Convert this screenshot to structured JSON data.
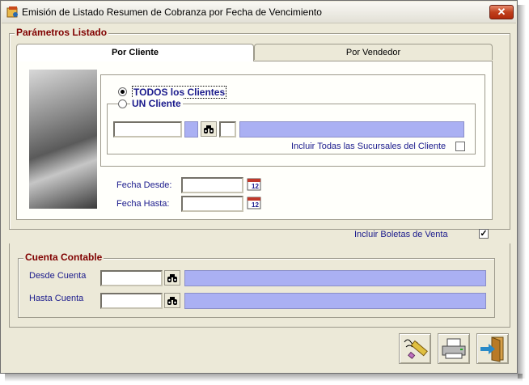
{
  "window": {
    "title": "Emisión de Listado Resumen de Cobranza por Fecha de Vencimiento",
    "close_glyph": "✕"
  },
  "parametros": {
    "label": "Parámetros Listado",
    "tabs": [
      {
        "label": "Por Cliente",
        "active": true
      },
      {
        "label": "Por Vendedor",
        "active": false
      }
    ],
    "radio_todos": "TODOS los Clientes",
    "radio_uno": "UN Cliente",
    "selected": "TODOS los Clientes",
    "cliente_codigo": "",
    "cliente_suc": "",
    "cliente_nro": "",
    "cliente_nombre": "",
    "incluir_sucursales_label": "Incluir Todas las Sucursales del Cliente",
    "incluir_sucursales_checked": false,
    "fecha_desde_label": "Fecha Desde:",
    "fecha_desde_value": "",
    "fecha_hasta_label": "Fecha Hasta:",
    "fecha_hasta_value": ""
  },
  "boletas": {
    "label": "Incluir Boletas de Venta",
    "checked": true,
    "check_glyph": "✓"
  },
  "cuenta": {
    "label": "Cuenta Contable",
    "desde_label": "Desde Cuenta",
    "desde_value": "",
    "desde_desc": "",
    "hasta_label": "Hasta Cuenta",
    "hasta_value": "",
    "hasta_desc": ""
  },
  "icons": {
    "binoculars": "binoculars-icon",
    "calendar": "calendar-icon",
    "edit": "edit-pencil-icon",
    "print": "printer-icon",
    "exit": "exit-door-icon"
  },
  "colors": {
    "lavender_field": "#aab0f3",
    "group_title": "#800000",
    "label_blue": "#1a1a8c"
  }
}
